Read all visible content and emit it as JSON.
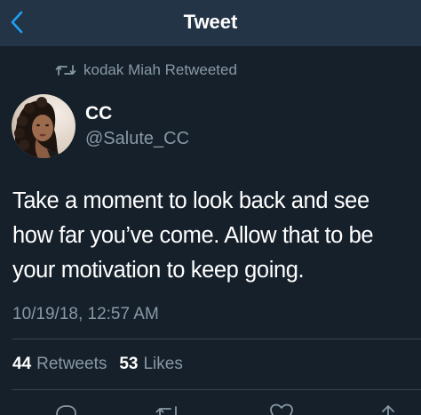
{
  "header": {
    "title": "Tweet",
    "back_icon": "chevron-left-icon"
  },
  "retweet_context": {
    "icon": "retweet-icon",
    "text": "kodak Miah Retweeted"
  },
  "author": {
    "name": "CC",
    "handle": "@Salute_CC"
  },
  "tweet": {
    "lines": [
      "Take a moment to look back and see",
      "how far you’ve come. Allow that to be",
      "your motivation to keep going."
    ],
    "timestamp": "10/19/18, 12:57 AM"
  },
  "stats": {
    "retweets_count": "44",
    "retweets_label": "Retweets",
    "likes_count": "53",
    "likes_label": "Likes"
  },
  "actions": [
    "reply-icon",
    "retweet-icon",
    "like-icon",
    "share-icon"
  ],
  "colors": {
    "background": "#15202b",
    "header_background": "#243447",
    "accent": "#1da1f2",
    "secondary_text": "#8899a6",
    "primary_text": "#ffffff",
    "divider": "#38444d"
  }
}
